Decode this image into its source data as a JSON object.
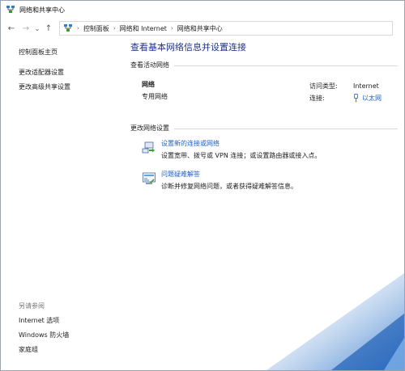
{
  "window": {
    "title": "网络和共享中心"
  },
  "toolbar": {
    "breadcrumbs": [
      "控制面板",
      "网络和 Internet",
      "网络和共享中心"
    ]
  },
  "sidebar": {
    "home": "控制面板主页",
    "items": [
      "更改适配器设置",
      "更改高级共享设置"
    ]
  },
  "see_also": {
    "title": "另请参阅",
    "items": [
      "Internet 选项",
      "Windows 防火墙",
      "家庭组"
    ]
  },
  "main": {
    "title": "查看基本网络信息并设置连接",
    "active_section": "查看活动网络",
    "network": {
      "name": "网络",
      "type": "专用网络",
      "access_label": "访问类型:",
      "access_value": "Internet",
      "connection_label": "连接:",
      "connection_value": "以太网"
    },
    "change_section": "更改网络设置",
    "tasks": [
      {
        "link": "设置新的连接或网络",
        "desc": "设置宽带、拨号或 VPN 连接；或设置路由器或接入点。"
      },
      {
        "link": "问题疑难解答",
        "desc": "诊断并修复网络问题，或者获得疑难解答信息。"
      }
    ]
  },
  "icons": {
    "title": "network-center-icon",
    "back": "back-arrow-icon",
    "forward": "forward-arrow-icon",
    "up": "up-arrow-icon",
    "address": "network-center-icon",
    "ethernet": "ethernet-icon",
    "new_connection": "new-connection-icon",
    "troubleshoot": "troubleshoot-icon"
  },
  "colors": {
    "link": "#1f5fbf",
    "title": "#1e3287",
    "wallpaper": "#2a72c8"
  }
}
